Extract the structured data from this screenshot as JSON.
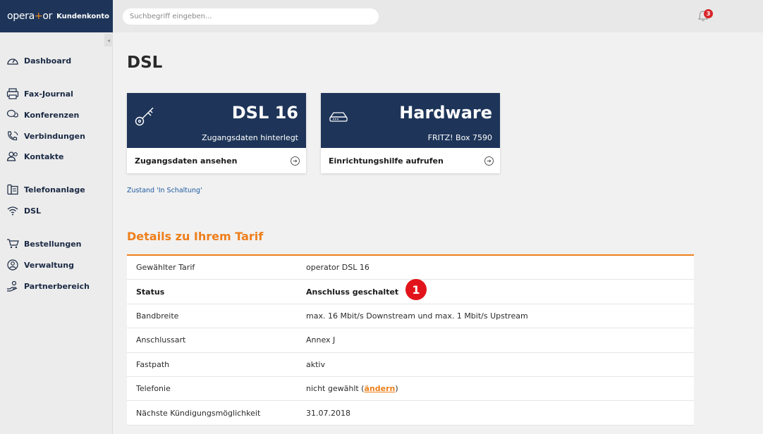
{
  "brand": {
    "logo_left": "opera",
    "logo_plus": "+",
    "logo_right": "or",
    "subtitle": "Kundenkonto"
  },
  "search": {
    "placeholder": "Suchbegriff eingeben..."
  },
  "notifications": {
    "count": "3"
  },
  "sidebar": {
    "items": [
      {
        "label": "Dashboard",
        "icon": "speedometer-icon"
      },
      {
        "label": "Fax-Journal",
        "icon": "printer-icon"
      },
      {
        "label": "Konferenzen",
        "icon": "chat-icon"
      },
      {
        "label": "Verbindungen",
        "icon": "phone-icon"
      },
      {
        "label": "Kontakte",
        "icon": "contacts-icon"
      },
      {
        "label": "Telefonanlage",
        "icon": "pbx-icon"
      },
      {
        "label": "DSL",
        "icon": "wifi-icon"
      },
      {
        "label": "Bestellungen",
        "icon": "cart-icon"
      },
      {
        "label": "Verwaltung",
        "icon": "user-circle-icon"
      },
      {
        "label": "Partnerbereich",
        "icon": "partner-icon"
      }
    ]
  },
  "page": {
    "title": "DSL"
  },
  "cards": [
    {
      "big": "DSL 16",
      "small": "Zugangsdaten hinterlegt",
      "action": "Zugangsdaten ansehen",
      "icon": "key-icon"
    },
    {
      "big": "Hardware",
      "small": "FRITZ! Box 7590",
      "action": "Einrichtungshilfe aufrufen",
      "icon": "router-icon"
    }
  ],
  "state_link": "Zustand 'In Schaltung'",
  "details": {
    "title": "Details zu Ihrem Tarif",
    "rows": [
      {
        "key": "Gewählter Tarif",
        "value": "operator DSL 16"
      },
      {
        "key": "Status",
        "value": "Anschluss geschaltet"
      },
      {
        "key": "Bandbreite",
        "value": "max. 16 Mbit/s Downstream und max. 1 Mbit/s Upstream"
      },
      {
        "key": "Anschlussart",
        "value": "Annex J"
      },
      {
        "key": "Fastpath",
        "value": "aktiv"
      },
      {
        "key": "Telefonie",
        "value": "nicht gewählt (",
        "link": "ändern",
        "suffix": ")"
      },
      {
        "key": "Nächste Kündigungsmöglichkeit",
        "value": "31.07.2018"
      }
    ]
  },
  "marker": {
    "label": "1"
  },
  "colors": {
    "navy": "#1e3559",
    "orange": "#ee7f1b",
    "red": "#e2141b"
  }
}
